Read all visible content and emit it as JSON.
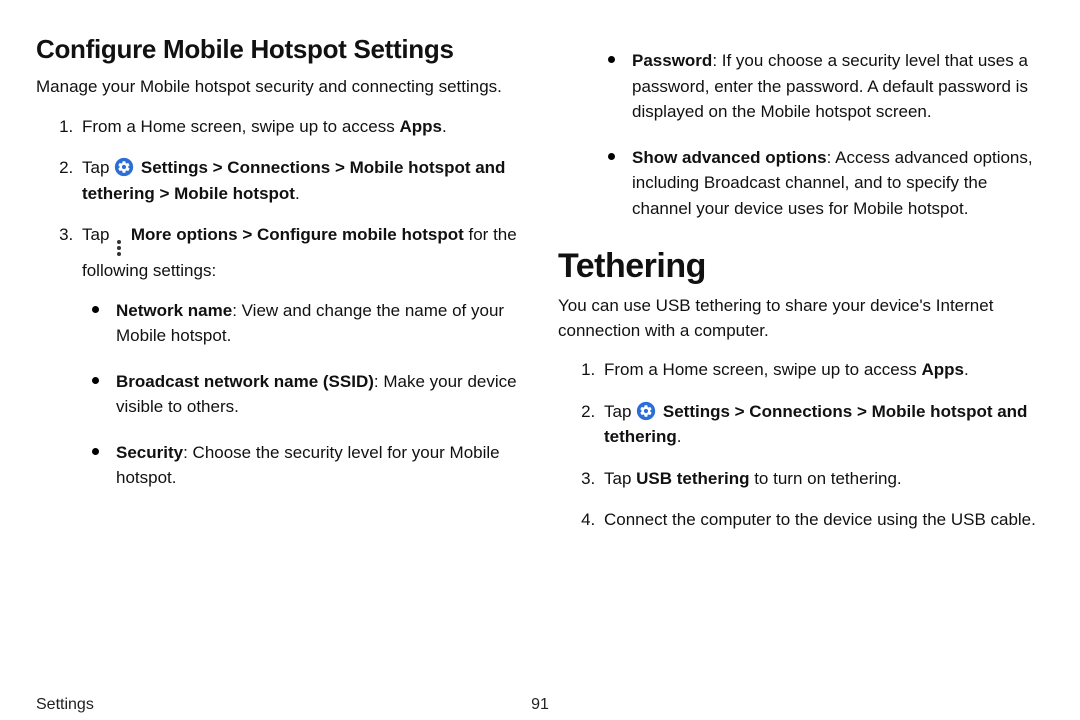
{
  "left": {
    "heading": "Configure Mobile Hotspot Settings",
    "intro": "Manage your Mobile hotspot security and connecting settings.",
    "step1_a": "From a Home screen, swipe up to access ",
    "step1_b": "Apps",
    "step1_c": ".",
    "step2_a": "Tap ",
    "step2_b": "Settings > Connections > Mobile hotspot and tethering > Mobile hotspot",
    "step2_c": ".",
    "step3_a": "Tap ",
    "step3_b": "More options > Configure mobile hotspot",
    "step3_c": " for the following settings:",
    "b1_label": "Network name",
    "b1_text": ": View and change the name of your Mobile hotspot.",
    "b2_label": "Broadcast network name (SSID)",
    "b2_text": ": Make your device visible to others.",
    "b3_label": "Security",
    "b3_text": ": Choose the security level for your Mobile hotspot."
  },
  "right": {
    "b4_label": "Password",
    "b4_text": ": If you choose a security level that uses a password, enter the password. A default password is displayed on the Mobile hotspot screen.",
    "b5_label": "Show advanced options",
    "b5_text": ": Access advanced options, including Broadcast channel, and to specify the channel your device uses for Mobile hotspot.",
    "heading": "Tethering",
    "intro": "You can use USB tethering to share your device's Internet connection with a computer.",
    "s1_a": "From a Home screen, swipe up to access ",
    "s1_b": "Apps",
    "s1_c": ".",
    "s2_a": "Tap ",
    "s2_b": "Settings > Connections > Mobile hotspot and tethering",
    "s2_c": ".",
    "s3_a": "Tap ",
    "s3_b": "USB tethering",
    "s3_c": " to turn on tethering.",
    "s4": "Connect the computer to the device using the USB cable."
  },
  "footer": {
    "section": "Settings",
    "page": "91"
  }
}
